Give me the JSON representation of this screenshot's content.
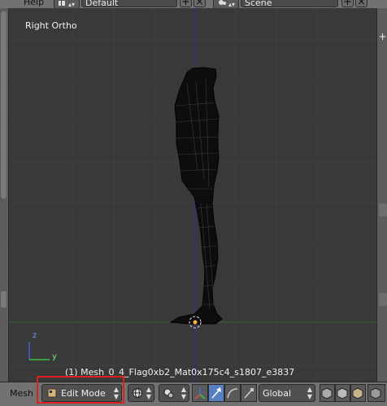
{
  "top_menu": {
    "help": "Help"
  },
  "top_fields": {
    "layout": "Default",
    "scene": "Scene"
  },
  "viewport": {
    "view_label": "Right Ortho",
    "object_info": "(1) Mesh_0_4_Flag0xb2_Mat0x175c4_s1807_e3837"
  },
  "axes": {
    "z": "z",
    "y": "y"
  },
  "footer": {
    "editor_label": "Mesh",
    "mode_value": "Edit Mode",
    "orientation_value": "Global"
  },
  "colors": {
    "viewport_bg": "#393939",
    "header_bg": "#727272",
    "accent_blue": "#5680c2",
    "highlight_red": "#e0201e",
    "y_axis_line": "#2f6d2f",
    "z_axis_line": "#2a2aa0"
  }
}
